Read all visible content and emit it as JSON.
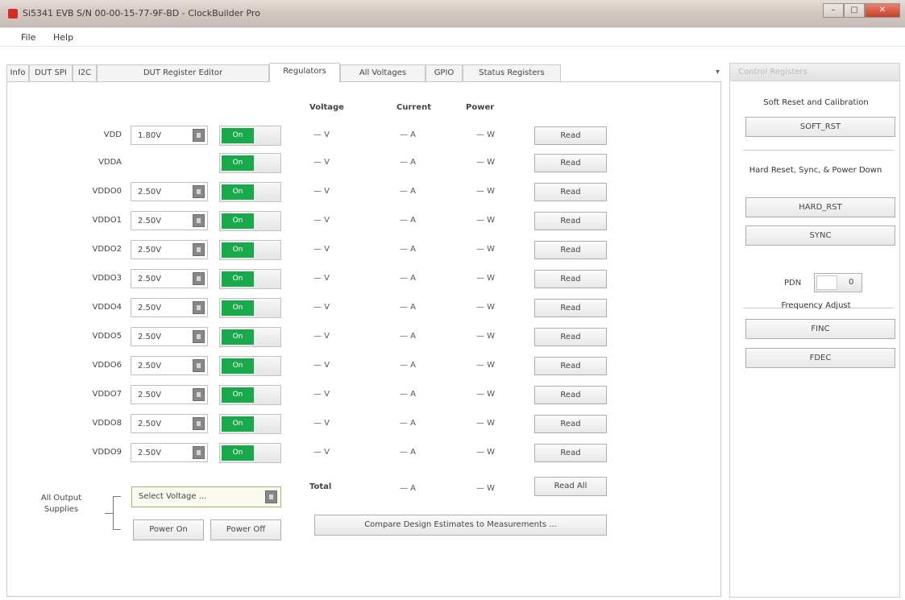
{
  "window": {
    "title": "Si5341 EVB S/N 00-00-15-77-9F-BD - ClockBuilder Pro",
    "buttons": {
      "minimize": "–",
      "maximize": "□",
      "close": "✕"
    }
  },
  "menu": {
    "file": "File",
    "help": "Help"
  },
  "tabs": [
    "Info",
    "DUT SPI",
    "I2C",
    "DUT Register Editor",
    "Regulators",
    "All Voltages",
    "GPIO",
    "Status Registers"
  ],
  "tabs_overflow": "▾",
  "headers": {
    "voltage": "Voltage",
    "current": "Current",
    "power": "Power"
  },
  "rows": [
    {
      "label": "VDD",
      "voltage_setting": "1.80V",
      "toggle": "On",
      "v": "— V",
      "a": "— A",
      "w": "— W",
      "read": "Read"
    },
    {
      "label": "VDDA",
      "voltage_setting": "",
      "toggle": "On",
      "v": "— V",
      "a": "— A",
      "w": "— W",
      "read": "Read"
    },
    {
      "label": "VDDO0",
      "voltage_setting": "2.50V",
      "toggle": "On",
      "v": "— V",
      "a": "— A",
      "w": "— W",
      "read": "Read"
    },
    {
      "label": "VDDO1",
      "voltage_setting": "2.50V",
      "toggle": "On",
      "v": "— V",
      "a": "— A",
      "w": "— W",
      "read": "Read"
    },
    {
      "label": "VDDO2",
      "voltage_setting": "2.50V",
      "toggle": "On",
      "v": "— V",
      "a": "— A",
      "w": "— W",
      "read": "Read"
    },
    {
      "label": "VDDO3",
      "voltage_setting": "2.50V",
      "toggle": "On",
      "v": "— V",
      "a": "— A",
      "w": "— W",
      "read": "Read"
    },
    {
      "label": "VDDO4",
      "voltage_setting": "2.50V",
      "toggle": "On",
      "v": "— V",
      "a": "— A",
      "w": "— W",
      "read": "Read"
    },
    {
      "label": "VDDO5",
      "voltage_setting": "2.50V",
      "toggle": "On",
      "v": "— V",
      "a": "— A",
      "w": "— W",
      "read": "Read"
    },
    {
      "label": "VDDO6",
      "voltage_setting": "2.50V",
      "toggle": "On",
      "v": "— V",
      "a": "— A",
      "w": "— W",
      "read": "Read"
    },
    {
      "label": "VDDO7",
      "voltage_setting": "2.50V",
      "toggle": "On",
      "v": "— V",
      "a": "— A",
      "w": "— W",
      "read": "Read"
    },
    {
      "label": "VDDO8",
      "voltage_setting": "2.50V",
      "toggle": "On",
      "v": "— V",
      "a": "— A",
      "w": "— W",
      "read": "Read"
    },
    {
      "label": "VDDO9",
      "voltage_setting": "2.50V",
      "toggle": "On",
      "v": "— V",
      "a": "— A",
      "w": "— W",
      "read": "Read"
    }
  ],
  "total": {
    "label": "Total",
    "a": "— A",
    "w": "— W",
    "read_all": "Read All"
  },
  "all_outputs": {
    "label": "All Output Supplies",
    "select_placeholder": "Select Voltage ...",
    "power_on": "Power On",
    "power_off": "Power Off"
  },
  "compare_button": "Compare Design Estimates to Measurements ...",
  "control_panel": {
    "header": "Control Registers",
    "soft_reset_title": "Soft Reset and Calibration",
    "soft_rst": "SOFT_RST",
    "hard_reset_title": "Hard Reset, Sync, & Power Down",
    "hard_rst": "HARD_RST",
    "sync": "SYNC",
    "pdn_label": "PDN",
    "pdn_value": "0",
    "freq_title": "Frequency Adjust",
    "finc": "FINC",
    "fdec": "FDEC"
  },
  "colors": {
    "toggle_on": "#19a84a",
    "close_button": "#c8412c"
  },
  "icons": [
    "app-icon",
    "dropdown-arrow-icon",
    "tab-overflow-arrow-icon"
  ]
}
